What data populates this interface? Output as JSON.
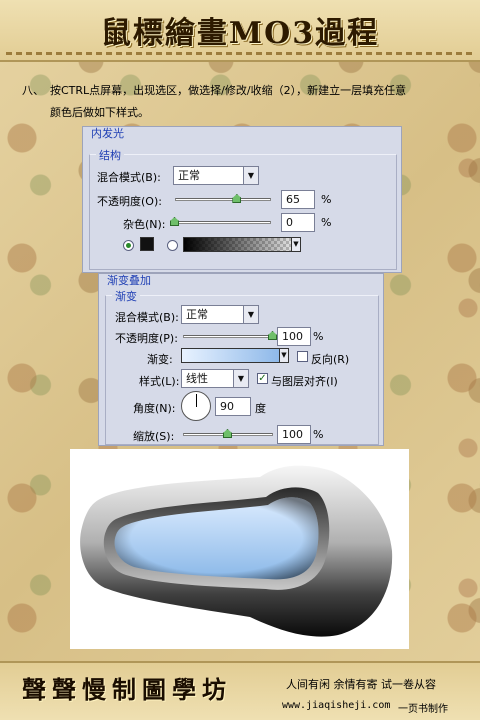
{
  "header": {
    "title": "鼠標繪畫MO3過程"
  },
  "instructions": {
    "step_number": "八、",
    "line1": "按CTRL点屏幕，出现选区，做选择/修改/收缩（2），新建立一层填充任意",
    "line2": "颜色后做如下样式。"
  },
  "inner_glow_panel": {
    "title": "内发光",
    "group_label": "结构",
    "blend_mode_label": "混合模式(B):",
    "blend_mode_value": "正常",
    "opacity_label": "不透明度(O):",
    "opacity_value": "65",
    "opacity_fraction": 0.65,
    "noise_label": "杂色(N):",
    "noise_value": "0",
    "noise_fraction": 0,
    "percent": "%",
    "color_swatch": "#111111"
  },
  "gradient_overlay_panel": {
    "title": "渐变叠加",
    "group_label": "渐变",
    "blend_mode_label": "混合模式(B):",
    "blend_mode_value": "正常",
    "opacity_label": "不透明度(P):",
    "opacity_value": "100",
    "opacity_fraction": 1.0,
    "gradient_label": "渐变:",
    "reverse_label": "反向(R)",
    "style_label": "样式(L):",
    "style_value": "线性",
    "align_label": "与图层对齐(I)",
    "angle_label": "角度(N):",
    "angle_value": "90",
    "degree_unit": "度",
    "scale_label": "缩放(S):",
    "scale_value": "100",
    "scale_fraction": 0.5,
    "percent": "%",
    "gradient_colors": [
      "#8ab6e8",
      "#e8f2ff"
    ]
  },
  "footer": {
    "studio_name": "聲聲慢制圖學坊",
    "motto": "人间有闲 余情有寄 试一卷从容",
    "site": "www.jiaqisheji.com",
    "credit": "一页书制作"
  },
  "colors": {
    "panel_bg": "#d6dae8",
    "panel_title": "#1f3fb4",
    "shape_fill_light": "#dcecff",
    "shape_fill_dark": "#8ab8e8"
  }
}
